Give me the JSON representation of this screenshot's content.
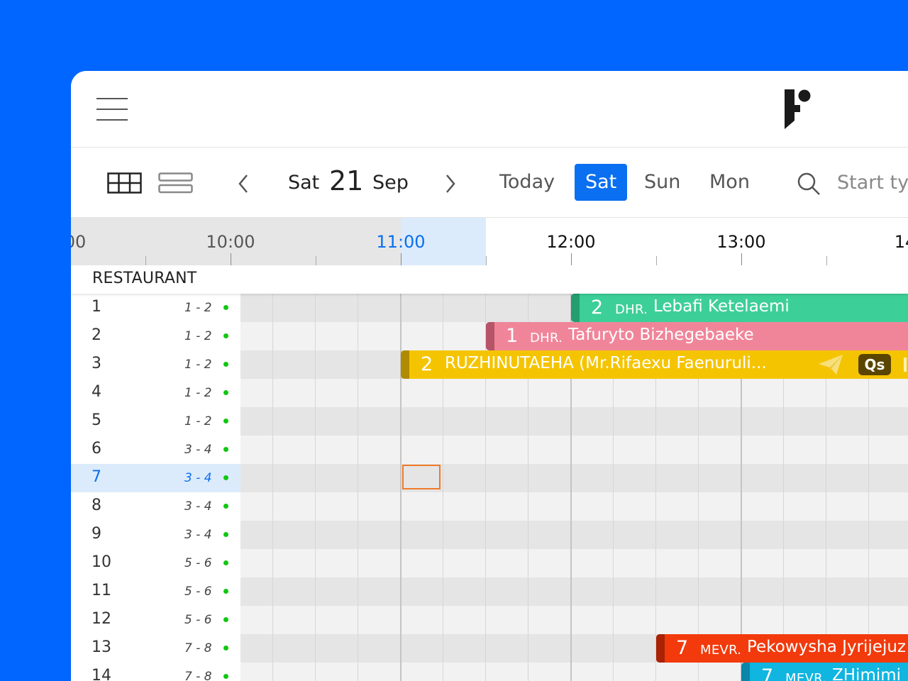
{
  "header": {
    "menu_icon": "hamburger-icon",
    "logo_icon": "brand-logo"
  },
  "toolbar": {
    "grid_view_icon": "grid-view-icon",
    "list_view_icon": "list-view-icon",
    "prev_icon": "chevron-left-icon",
    "next_icon": "chevron-right-icon",
    "date": {
      "weekday": "Sat",
      "day": "21",
      "month": "Sep"
    },
    "day_buttons": [
      {
        "label": "Today",
        "active": false
      },
      {
        "label": "Sat",
        "active": true
      },
      {
        "label": "Sun",
        "active": false
      },
      {
        "label": "Mon",
        "active": false
      }
    ],
    "search_icon": "search-icon",
    "search_placeholder": "Start ty"
  },
  "timeline": {
    "labels": [
      "00",
      "10:00",
      "11:00",
      "12:00",
      "13:00",
      "14"
    ],
    "current_hour": "11:00"
  },
  "section": {
    "title": "RESTAURANT"
  },
  "tables": [
    {
      "name": "1",
      "capacity": "1 - 2",
      "status": "available"
    },
    {
      "name": "2",
      "capacity": "1 - 2",
      "status": "available"
    },
    {
      "name": "3",
      "capacity": "1 - 2",
      "status": "available"
    },
    {
      "name": "4",
      "capacity": "1 - 2",
      "status": "available"
    },
    {
      "name": "5",
      "capacity": "1 - 2",
      "status": "available"
    },
    {
      "name": "6",
      "capacity": "3 - 4",
      "status": "available"
    },
    {
      "name": "7",
      "capacity": "3 - 4",
      "status": "available",
      "selected": true
    },
    {
      "name": "8",
      "capacity": "3 - 4",
      "status": "available"
    },
    {
      "name": "9",
      "capacity": "3 - 4",
      "status": "available"
    },
    {
      "name": "10",
      "capacity": "5 - 6",
      "status": "available"
    },
    {
      "name": "11",
      "capacity": "5 - 6",
      "status": "available"
    },
    {
      "name": "12",
      "capacity": "5 - 6",
      "status": "available"
    },
    {
      "name": "13",
      "capacity": "7 - 8",
      "status": "available"
    },
    {
      "name": "14",
      "capacity": "7 - 8",
      "status": "available"
    }
  ],
  "reservations": [
    {
      "guests": "2",
      "title": "DHR.",
      "name": "Lebafi Ketelaemi",
      "color": "#3dcf98",
      "edge": "#249e6e"
    },
    {
      "guests": "1",
      "title": "DHR.",
      "name": "Tafuryto Bizhegebaeke",
      "color": "#f0859a",
      "edge": "#b85468"
    },
    {
      "guests": "2",
      "title": "",
      "name": "RUZHINUTAEHA (Mr.Rifaexu Faenuruli...",
      "color": "#f5c400",
      "edge": "#b08a00",
      "badge": "Qs",
      "icon": "paper-plane-icon"
    },
    {
      "guests": "7",
      "title": "MEVR.",
      "name": "Pekowysha Jyrijejuz",
      "color": "#f23a0c",
      "edge": "#a82203"
    },
    {
      "guests": "7",
      "title": "MEVR.",
      "name": "ZHimimi",
      "color": "#10b5e0",
      "edge": "#0a86a8"
    }
  ]
}
